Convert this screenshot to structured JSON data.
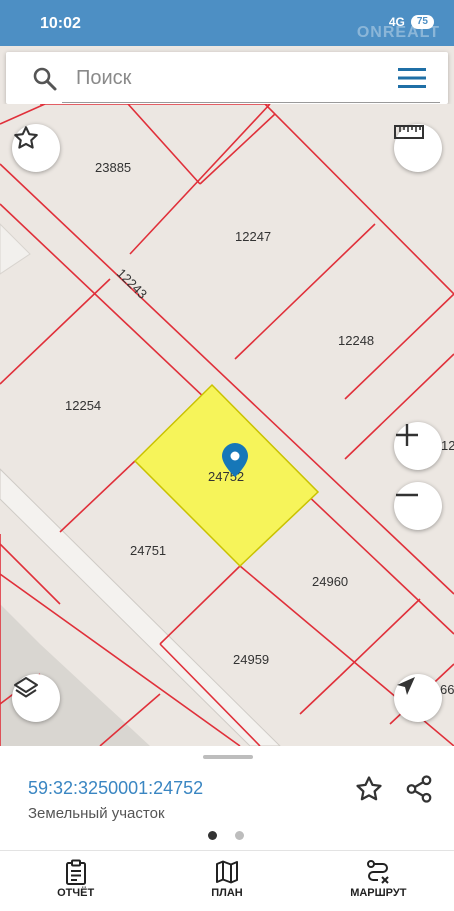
{
  "status_bar": {
    "time": "10:02",
    "network": "4G",
    "battery": "75",
    "watermark": "ONREALT"
  },
  "search": {
    "placeholder": "Поиск",
    "icon": "search-icon",
    "menu_icon": "hamburger-menu-icon"
  },
  "map": {
    "parcels": [
      {
        "number": "23885"
      },
      {
        "number": "12247"
      },
      {
        "number": "12243"
      },
      {
        "number": "12248"
      },
      {
        "number": "12254"
      },
      {
        "number": "12"
      },
      {
        "number": "24752",
        "selected": true
      },
      {
        "number": "24751"
      },
      {
        "number": "24960"
      },
      {
        "number": "24959"
      },
      {
        "number": "66"
      }
    ],
    "colors": {
      "background": "#ece7e2",
      "boundary": "#e0303a",
      "selected_fill": "#f6f45a",
      "marker": "#1677b8"
    },
    "controls": {
      "favorite": "star-outline-icon",
      "ruler": "ruler-icon",
      "zoom_in": "plus-icon",
      "zoom_out": "minus-icon",
      "layers": "layers-icon",
      "locate": "navigation-arrow-icon"
    }
  },
  "sheet": {
    "cadastral_number": "59:32:3250001:24752",
    "object_type": "Земельный участок",
    "page_count": 2,
    "active_page": 1
  },
  "nav": {
    "items": [
      {
        "label": "ОТЧЁТ",
        "icon": "clipboard-icon"
      },
      {
        "label": "ПЛАН",
        "icon": "map-icon"
      },
      {
        "label": "МАРШРУТ",
        "icon": "route-icon"
      }
    ]
  }
}
